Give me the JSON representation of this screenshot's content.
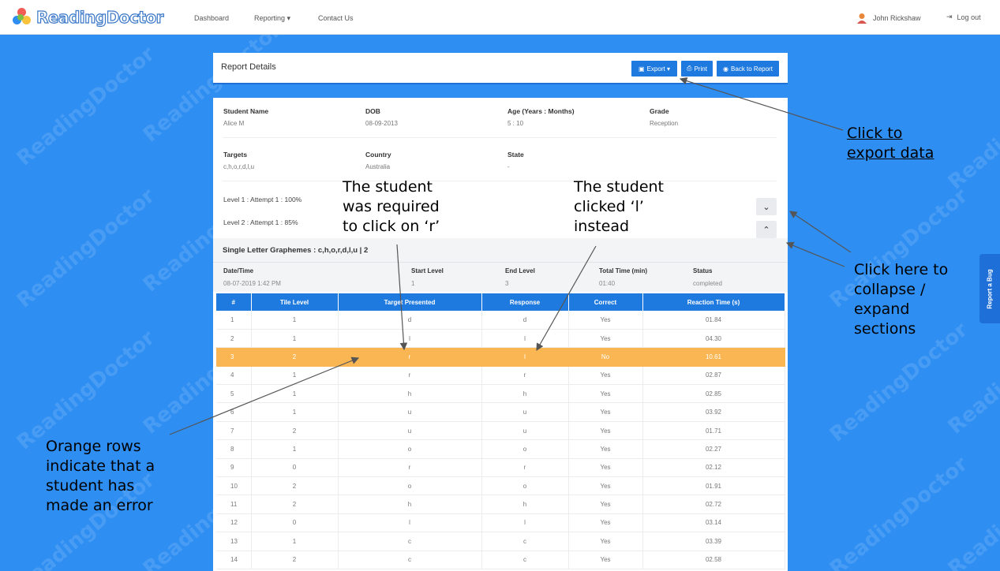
{
  "nav": {
    "brand": "ReadingDoctor",
    "links": [
      "Dashboard",
      "Reporting ▾",
      "Contact Us"
    ],
    "user_name": "John Rickshaw",
    "logout": "Log out"
  },
  "watermark": "ReadingDoctor",
  "header": {
    "title": "Report Details",
    "export_label": "Export ▾",
    "print_label": "Print",
    "back_label": "Back to Report"
  },
  "student": {
    "name_label": "Student Name",
    "name": "Alice M",
    "dob_label": "DOB",
    "dob": "08-09-2013",
    "age_label": "Age (Years : Months)",
    "age": "5 : 10",
    "grade_label": "Grade",
    "grade": "Reception",
    "targets_label": "Targets",
    "targets": "c,h,o,r,d,l,u",
    "country_label": "Country",
    "country": "Australia",
    "state_label": "State",
    "state": "-"
  },
  "levels": [
    "Level 1 : Attempt 1 : 100%",
    "Level 2 : Attempt 1 : 85%"
  ],
  "section": {
    "title": "Single Letter Graphemes : c,h,o,r,d,l,u | 2",
    "datetime_label": "Date/Time",
    "datetime": "08-07-2019 1:42 PM",
    "start_label": "Start Level",
    "start": "1",
    "end_label": "End Level",
    "end": "3",
    "time_label": "Total Time (min)",
    "time": "01:40",
    "status_label": "Status",
    "status": "completed"
  },
  "table": {
    "headers": [
      "#",
      "Tile Level",
      "Target Presented",
      "Response",
      "Correct",
      "Reaction Time (s)"
    ],
    "rows": [
      [
        "1",
        "1",
        "d",
        "d",
        "Yes",
        "01.84"
      ],
      [
        "2",
        "1",
        "l",
        "l",
        "Yes",
        "04.30"
      ],
      [
        "3",
        "2",
        "r",
        "l",
        "No",
        "10.61"
      ],
      [
        "4",
        "1",
        "r",
        "r",
        "Yes",
        "02.87"
      ],
      [
        "5",
        "1",
        "h",
        "h",
        "Yes",
        "02.85"
      ],
      [
        "6",
        "1",
        "u",
        "u",
        "Yes",
        "03.92"
      ],
      [
        "7",
        "2",
        "u",
        "u",
        "Yes",
        "01.71"
      ],
      [
        "8",
        "1",
        "o",
        "o",
        "Yes",
        "02.27"
      ],
      [
        "9",
        "0",
        "r",
        "r",
        "Yes",
        "02.12"
      ],
      [
        "10",
        "2",
        "o",
        "o",
        "Yes",
        "01.91"
      ],
      [
        "11",
        "2",
        "h",
        "h",
        "Yes",
        "02.72"
      ],
      [
        "12",
        "0",
        "l",
        "l",
        "Yes",
        "03.14"
      ],
      [
        "13",
        "1",
        "c",
        "c",
        "Yes",
        "03.39"
      ],
      [
        "14",
        "2",
        "c",
        "c",
        "Yes",
        "02.58"
      ]
    ],
    "error_row_index": 2,
    "error_color": "#f9b653",
    "header_color": "#1f7ae0"
  },
  "annotations": {
    "export": [
      "Click to",
      "export data"
    ],
    "required": [
      "The student",
      "was required",
      "to click on ‘r’"
    ],
    "clicked": [
      "The student",
      "clicked ‘l’",
      "instead"
    ],
    "collapse": [
      "Click here to",
      "collapse /",
      "expand",
      "sections"
    ],
    "orange": [
      "Orange rows",
      "indicate that a",
      "student has",
      "made an error"
    ]
  },
  "bug_button": "Report a Bug"
}
